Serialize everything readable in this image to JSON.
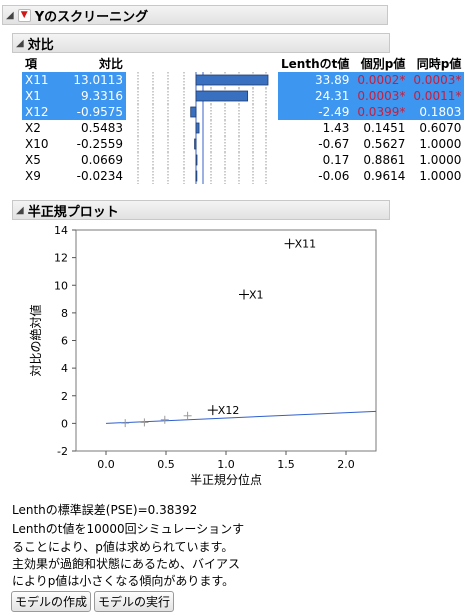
{
  "report": {
    "title": "Yのスクリーニング"
  },
  "contrast": {
    "title": "対比",
    "headers": {
      "term": "項",
      "contrast": "対比",
      "lenth_t": "Lenthのt値",
      "individual_p": "個別p値",
      "simultaneous_p": "同時p値"
    },
    "rows": [
      {
        "term": "X11",
        "contrast": "13.0113",
        "lenth_t": "33.89",
        "individual_p": "0.0002*",
        "simultaneous_p": "0.0003*",
        "selected": true,
        "bar": 13.0113
      },
      {
        "term": "X1",
        "contrast": "9.3316",
        "lenth_t": "24.31",
        "individual_p": "0.0003*",
        "simultaneous_p": "0.0011*",
        "selected": true,
        "bar": 9.3316
      },
      {
        "term": "X12",
        "contrast": "-0.9575",
        "lenth_t": "-2.49",
        "individual_p": "0.0399*",
        "simultaneous_p": "0.1803",
        "selected": true,
        "bar": -0.9575
      },
      {
        "term": "X2",
        "contrast": "0.5483",
        "lenth_t": "1.43",
        "individual_p": "0.1451",
        "simultaneous_p": "0.6070",
        "selected": false,
        "bar": 0.5483
      },
      {
        "term": "X10",
        "contrast": "-0.2559",
        "lenth_t": "-0.67",
        "individual_p": "0.5627",
        "simultaneous_p": "1.0000",
        "selected": false,
        "bar": -0.2559
      },
      {
        "term": "X5",
        "contrast": "0.0669",
        "lenth_t": "0.17",
        "individual_p": "0.8861",
        "simultaneous_p": "1.0000",
        "selected": false,
        "bar": 0.0669
      },
      {
        "term": "X9",
        "contrast": "-0.0234",
        "lenth_t": "-0.06",
        "individual_p": "0.9614",
        "simultaneous_p": "1.0000",
        "selected": false,
        "bar": -0.0234
      }
    ]
  },
  "half_normal": {
    "title": "半正規プロット",
    "chart_data": {
      "type": "scatter",
      "xlabel": "半正規分位点",
      "ylabel": "対比の絶対値",
      "xlim": [
        -0.25,
        2.25
      ],
      "ylim": [
        -2,
        14
      ],
      "xticks": [
        "0.0",
        "0.5",
        "1.0",
        "1.5",
        "2.0"
      ],
      "yticks": [
        "-2",
        "0",
        "2",
        "4",
        "6",
        "8",
        "10",
        "12",
        "14"
      ],
      "points": [
        {
          "x": 0.16,
          "y": 0.02,
          "label": ""
        },
        {
          "x": 0.32,
          "y": 0.07,
          "label": ""
        },
        {
          "x": 0.49,
          "y": 0.26,
          "label": ""
        },
        {
          "x": 0.68,
          "y": 0.55,
          "label": ""
        },
        {
          "x": 0.89,
          "y": 0.96,
          "label": "X12"
        },
        {
          "x": 1.15,
          "y": 9.33,
          "label": "X1"
        },
        {
          "x": 1.53,
          "y": 13.01,
          "label": "X11"
        }
      ],
      "line": {
        "x": [
          0.0,
          2.25
        ],
        "y": [
          0.0,
          0.87
        ],
        "color": "#2f5fcf"
      }
    }
  },
  "notes": [
    "Lenthの標準誤差(PSE)=0.38392",
    "Lenthのt値を10000回シミュレーションす",
    "ることにより、p値は求められています。",
    "主効果が過飽和状態にあるため、バイアス",
    "によりp値は小さくなる傾向があります。"
  ],
  "buttons": {
    "make_model": "モデルの作成",
    "run_model": "モデルの実行"
  },
  "colors": {
    "selection": "#3d96f0",
    "significant": "#d52020",
    "bar_fill": "#3a70c0"
  }
}
